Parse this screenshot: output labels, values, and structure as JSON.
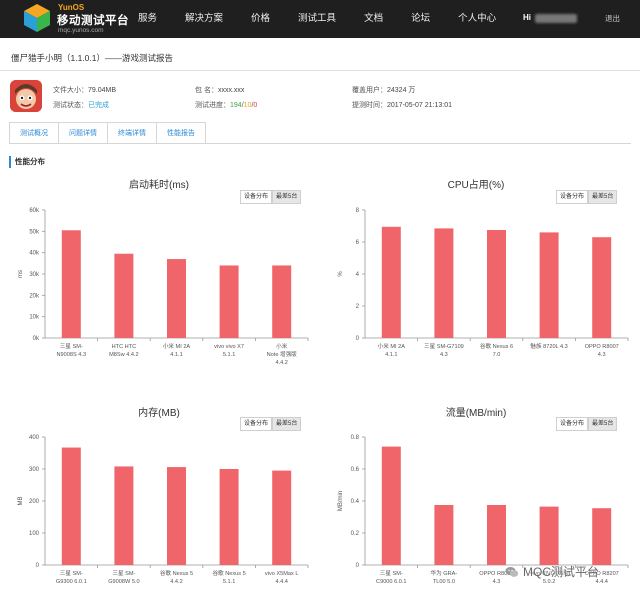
{
  "header": {
    "brand_small": "YunOS",
    "brand_main": "移动测试平台",
    "brand_url": "mqc.yunos.com",
    "nav": [
      "服务",
      "解决方案",
      "价格",
      "测试工具",
      "文档",
      "论坛",
      "个人中心"
    ],
    "greeting": "Hi",
    "logout": "退出"
  },
  "page_title": "僵尸猎手小明（1.1.0.1）——游戏测试报告",
  "app_info": {
    "size_label": "文件大小：",
    "size_value": "79.04MB",
    "package_label": "包    名：",
    "package_value": "xxxx.xxx",
    "coverage_label": "覆盖用户：",
    "coverage_value": "24324 万",
    "status_label": "测试状态：",
    "status_value": "已完成",
    "progress_label": "测试进度：",
    "progress_done": "194",
    "progress_total": "10",
    "progress_fail": "0",
    "submit_label": "提测时间：",
    "submit_value": "2017-05-07 21:13:01"
  },
  "tabs": [
    "测试概况",
    "问题详情",
    "终端详情",
    "性能报告"
  ],
  "active_tab": 3,
  "section_title": "性能分布",
  "toggle": {
    "option_a": "设备分布",
    "option_b": "最差5台"
  },
  "bar_color": "#f0656a",
  "chart_data": [
    {
      "type": "bar",
      "title": "启动耗时(ms)",
      "ylabel": "ms",
      "ylim": [
        0,
        60000
      ],
      "yticks": [
        "0k",
        "10k",
        "20k",
        "30k",
        "40k",
        "50k",
        "60k"
      ],
      "categories": [
        [
          "三星 SM-",
          "N9008S 4.3"
        ],
        [
          "HTC HTC",
          "M8Sw 4.4.2"
        ],
        [
          "小米 MI 2A",
          "4.1.1"
        ],
        [
          "vivo vivo X7",
          "5.1.1"
        ],
        [
          "小米",
          "Note 增强版",
          "4.4.2"
        ]
      ],
      "values": [
        50500,
        39500,
        37000,
        34000,
        34000
      ]
    },
    {
      "type": "bar",
      "title": "CPU占用(%)",
      "ylabel": "%",
      "ylim": [
        0,
        8
      ],
      "yticks": [
        "0",
        "2",
        "4",
        "6",
        "8"
      ],
      "categories": [
        [
          "小米 MI 2A",
          "4.1.1"
        ],
        [
          "三星 SM-G7109",
          "4.3"
        ],
        [
          "谷歌 Nexus 6",
          "7.0"
        ],
        [
          "魅族 8720L 4.3"
        ],
        [
          "OPPO R8007",
          "4.3"
        ]
      ],
      "values": [
        6.95,
        6.85,
        6.75,
        6.6,
        6.3
      ]
    },
    {
      "type": "bar",
      "title": "内存(MB)",
      "ylabel": "MB",
      "ylim": [
        0,
        400
      ],
      "yticks": [
        "0",
        "100",
        "200",
        "300",
        "400"
      ],
      "categories": [
        [
          "三星 SM-",
          "G9300 6.0.1"
        ],
        [
          "三星 SM-",
          "G9008W 5.0"
        ],
        [
          "谷歌 Nexus 5",
          "4.4.2"
        ],
        [
          "谷歌 Nexus 5",
          "5.1.1"
        ],
        [
          "vivo X5Max L",
          "4.4.4"
        ]
      ],
      "values": [
        367,
        308,
        306,
        300,
        295
      ]
    },
    {
      "type": "bar",
      "title": "流量(MB/min)",
      "ylabel": "MB/min",
      "ylim": [
        0,
        0.8
      ],
      "yticks": [
        "0",
        "0.2",
        "0.4",
        "0.6",
        "0.8"
      ],
      "categories": [
        [
          "三星 SM-",
          "C9000 6.0.1"
        ],
        [
          "华为 GRA-",
          "TL00 5.0"
        ],
        [
          "OPPO R809T",
          "4.3"
        ],
        [
          "vivo VIVO X5M",
          "5.0.2"
        ],
        [
          "OPPO R8207",
          "4.4.4"
        ]
      ],
      "values": [
        0.74,
        0.375,
        0.375,
        0.365,
        0.355
      ]
    }
  ],
  "watermark": "MQC测试平台"
}
